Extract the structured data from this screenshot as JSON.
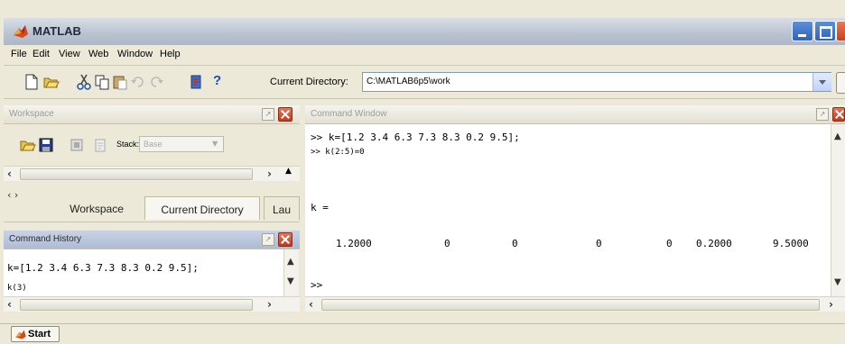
{
  "window": {
    "title": "MATLAB"
  },
  "menu": [
    "File",
    "Edit",
    "View",
    "Web",
    "Window",
    "Help"
  ],
  "toolbar": {
    "current_directory_label": "Current Directory:",
    "current_directory_value": "C:\\MATLAB6p5\\work"
  },
  "workspace": {
    "title": "Workspace",
    "stack_label": "Stack:",
    "stack_value": "Base"
  },
  "tabs": [
    "Workspace",
    "Current Directory",
    "Lau"
  ],
  "command_history": {
    "title": "Command History",
    "lines": [
      "k=[1.2 3.4 6.3 7.3 8.3 0.2 9.5];",
      "k(3)"
    ]
  },
  "command_window": {
    "title": "Command Window",
    "cmd1": ">> k=[1.2 3.4 6.3 7.3 8.3 0.2 9.5];",
    "cmd2": ">> k(2:5)=0",
    "result_label": "k =",
    "values": [
      "1.2000",
      "0",
      "0",
      "0",
      "0",
      "0.2000",
      "9.5000"
    ],
    "prompt": ">>"
  },
  "taskbar": {
    "start_label": "Start"
  }
}
